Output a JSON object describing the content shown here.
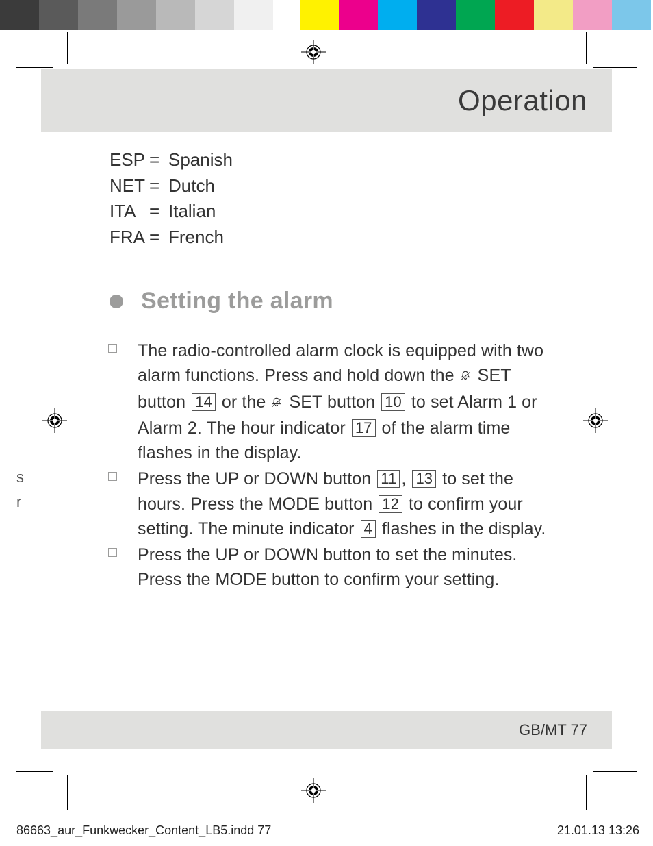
{
  "color_strip": {
    "left": [
      "#3b3b3b",
      "#5a5a5a",
      "#7a7a7a",
      "#9a9a9a",
      "#b9b9b9",
      "#d6d6d6",
      "#f0f0f0",
      "#ffffff"
    ],
    "right": [
      "#fff200",
      "#ec008c",
      "#00aeef",
      "#2e3192",
      "#00a651",
      "#ed1c24",
      "#f3ea88",
      "#f29ec4",
      "#7cc7ea"
    ]
  },
  "header": {
    "title": "Operation"
  },
  "languages": [
    {
      "code": "ESP",
      "name": "Spanish"
    },
    {
      "code": "NET",
      "name": "Dutch"
    },
    {
      "code": "ITA",
      "name": "Italian"
    },
    {
      "code": "FRA",
      "name": "French"
    }
  ],
  "lang_eq": "=",
  "section": {
    "title": "Setting the alarm"
  },
  "items": {
    "a": {
      "t1": "The radio-controlled alarm clock is equipped with two alarm functions. Press and hold down the ",
      "set1": " SET button ",
      "ref14": "14",
      "t2": " or the ",
      "set2": " SET button ",
      "ref10": "10",
      "t3": " to set Alarm 1 or Alarm 2. The hour indicator ",
      "ref17": "17",
      "t4": " of the alarm time flashes in the display."
    },
    "b": {
      "t1": "Press the UP or DOWN button ",
      "ref11": "11",
      "comma": ", ",
      "ref13": "13",
      "t2": " to set the hours. Press the MODE button ",
      "ref12": "12",
      "t3": " to confirm your setting. The minute indicator ",
      "ref4": "4",
      "t4": " flashes in the display."
    },
    "c": {
      "t1": "Press the UP or DOWN button to set the minutes. Press the MODE button to confirm your setting."
    }
  },
  "footer": {
    "region_page": "GB/MT   77"
  },
  "slug": {
    "left": "86663_aur_Funkwecker_Content_LB5.indd   77",
    "right": "21.01.13   13:26"
  },
  "stray": {
    "s1": "",
    "s2": "",
    "s3": "s",
    "s4": "r"
  }
}
